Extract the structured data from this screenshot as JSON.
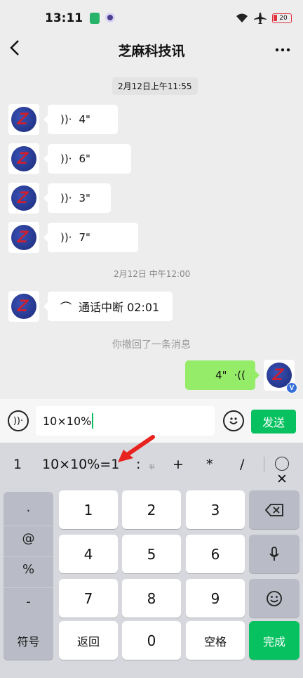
{
  "status": {
    "time": "13:11",
    "battery": "20"
  },
  "header": {
    "title": "芝麻科技讯",
    "back_icon": "chevron-left-icon",
    "more_icon": "more-icon"
  },
  "chat": {
    "date1": "2月12日上午11:55",
    "voices": [
      "4\"",
      "6\"",
      "3\"",
      "7\""
    ],
    "date2": "2月12日 中午12:00",
    "call": "通话中断 02:01",
    "recall": "你撤回了一条消息",
    "my_voice": "4\""
  },
  "input": {
    "value": "10×10%",
    "send": "发送"
  },
  "candidates": {
    "c1": "1",
    "c2": "10×10%=1",
    "c3": ":",
    "c3_small": "半",
    "c4": "+",
    "c5": "*",
    "c6": "/"
  },
  "keyboard": {
    "sym": [
      ".",
      "@",
      "%",
      "-"
    ],
    "digits": [
      "1",
      "2",
      "3",
      "4",
      "5",
      "6",
      "7",
      "8",
      "9",
      "0"
    ],
    "fuhao": "符号",
    "fanhui": "返回",
    "kongge": "空格",
    "wancheng": "完成"
  },
  "colors": {
    "accent": "#07c160",
    "my_bubble": "#95ec69",
    "annotation_arrow": "#e8231f"
  }
}
